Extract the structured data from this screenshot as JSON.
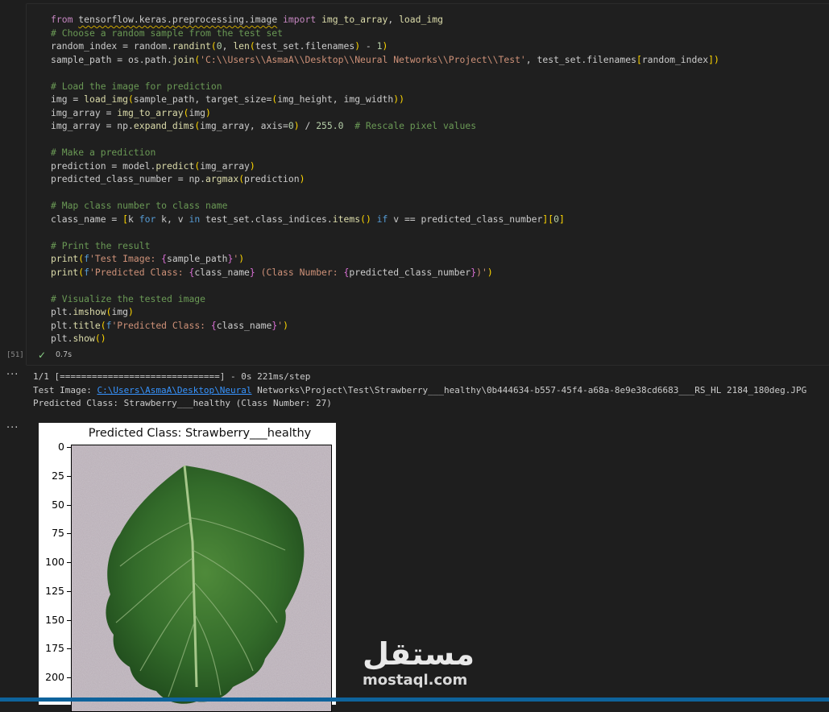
{
  "cell": {
    "execution_count": "[51]",
    "duration": "0.7s",
    "code_lines": [
      "from tensorflow.keras.preprocessing.image import img_to_array, load_img",
      "# Choose a random sample from the test set",
      "random_index = random.randint(0, len(test_set.filenames) - 1)",
      "sample_path = os.path.join('C:\\\\Users\\\\AsmaA\\\\Desktop\\\\Neural Networks\\\\Project\\\\Test', test_set.filenames[random_index])",
      "",
      "# Load the image for prediction",
      "img = load_img(sample_path, target_size=(img_height, img_width))",
      "img_array = img_to_array(img)",
      "img_array = np.expand_dims(img_array, axis=0) / 255.0  # Rescale pixel values",
      "",
      "# Make a prediction",
      "prediction = model.predict(img_array)",
      "predicted_class_number = np.argmax(prediction)",
      "",
      "# Map class number to class name",
      "class_name = [k for k, v in test_set.class_indices.items() if v == predicted_class_number][0]",
      "",
      "# Print the result",
      "print(f'Test Image: {sample_path}')",
      "print(f'Predicted Class: {class_name} (Class Number: {predicted_class_number})')",
      "",
      "# Visualize the tested image",
      "plt.imshow(img)",
      "plt.title(f'Predicted Class: {class_name}')",
      "plt.show()"
    ]
  },
  "output": {
    "more_label": "...",
    "progress_line": "1/1 [==============================] - 0s 221ms/step",
    "test_image_prefix": "Test Image: ",
    "test_image_link": "C:\\Users\\AsmaA\\Desktop\\Neural",
    "test_image_rest": " Networks\\Project\\Test\\Strawberry___healthy\\0b444634-b557-45f4-a68a-8e9e38cd6683___RS_HL 2184_180deg.JPG",
    "predicted_line": "Predicted Class: Strawberry___healthy (Class Number: 27)"
  },
  "figure": {
    "title": "Predicted Class: Strawberry___healthy",
    "y_ticks": [
      "0",
      "25",
      "50",
      "75",
      "100",
      "125",
      "150",
      "175",
      "200"
    ]
  },
  "watermark": {
    "arabic": "مستقل",
    "latin": "mostaql.com"
  },
  "colors": {
    "background": "#1e1e1e",
    "keyword": "#569cd6",
    "string": "#ce9178",
    "comment": "#6a9955",
    "function": "#dcdcaa",
    "link": "#3794ff",
    "success": "#89d185"
  }
}
